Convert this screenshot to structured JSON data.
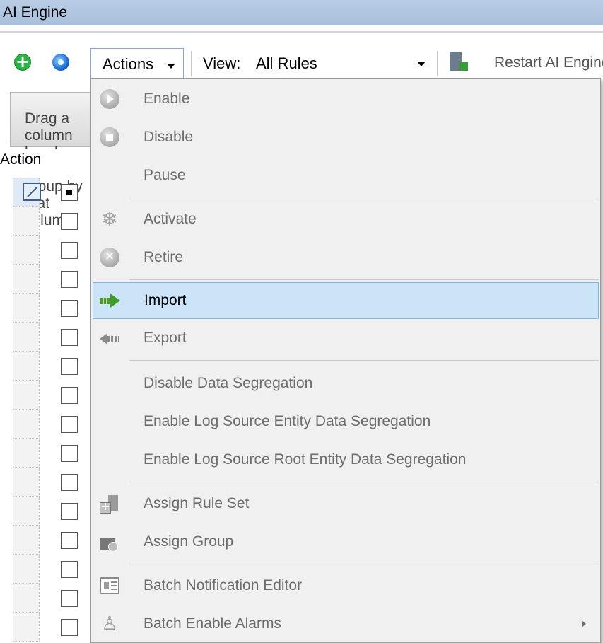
{
  "window": {
    "title": "AI Engine"
  },
  "toolbar": {
    "add_icon": "add-icon",
    "refresh_icon": "gear-icon",
    "actions_label": "Actions",
    "view_label": "View:",
    "view_value": "All Rules",
    "restart_label": "Restart AI Engine"
  },
  "grid": {
    "group_panel_text": "Drag a column header here to group by that column",
    "columns": [
      "Action"
    ],
    "rows": [
      {
        "checked": true
      },
      {
        "checked": false
      },
      {
        "checked": false
      },
      {
        "checked": false
      },
      {
        "checked": false
      },
      {
        "checked": false
      },
      {
        "checked": false
      },
      {
        "checked": false
      },
      {
        "checked": false
      },
      {
        "checked": false
      },
      {
        "checked": false
      },
      {
        "checked": false
      },
      {
        "checked": false
      },
      {
        "checked": false
      },
      {
        "checked": false
      },
      {
        "checked": false
      }
    ]
  },
  "menu": {
    "items": [
      {
        "label": "Enable",
        "icon": "play-icon",
        "enabled": false
      },
      {
        "label": "Disable",
        "icon": "stop-icon",
        "enabled": false
      },
      {
        "label": "Pause",
        "icon": "",
        "enabled": false
      },
      {
        "label": "Activate",
        "icon": "activate-icon",
        "enabled": false
      },
      {
        "label": "Retire",
        "icon": "retire-icon",
        "enabled": false
      },
      {
        "label": "Import",
        "icon": "import-icon",
        "enabled": true,
        "highlighted": true
      },
      {
        "label": "Export",
        "icon": "export-icon",
        "enabled": false
      },
      {
        "label": "Disable Data Segregation",
        "icon": "",
        "enabled": false
      },
      {
        "label": "Enable Log Source Entity Data Segregation",
        "icon": "",
        "enabled": false
      },
      {
        "label": "Enable Log Source Root Entity Data Segregation",
        "icon": "",
        "enabled": false
      },
      {
        "label": "Assign Rule Set",
        "icon": "rule-set-icon",
        "enabled": false
      },
      {
        "label": "Assign Group",
        "icon": "group-icon",
        "enabled": false
      },
      {
        "label": "Batch Notification Editor",
        "icon": "notification-icon",
        "enabled": false
      },
      {
        "label": "Batch Enable Alarms",
        "icon": "bell-icon",
        "enabled": false,
        "submenu": true
      }
    ]
  },
  "colors": {
    "title_bar": "#b9cde5",
    "highlight": "#cce4f7",
    "highlight_border": "#7fb6e8",
    "disabled_text": "#6d6d6d"
  }
}
